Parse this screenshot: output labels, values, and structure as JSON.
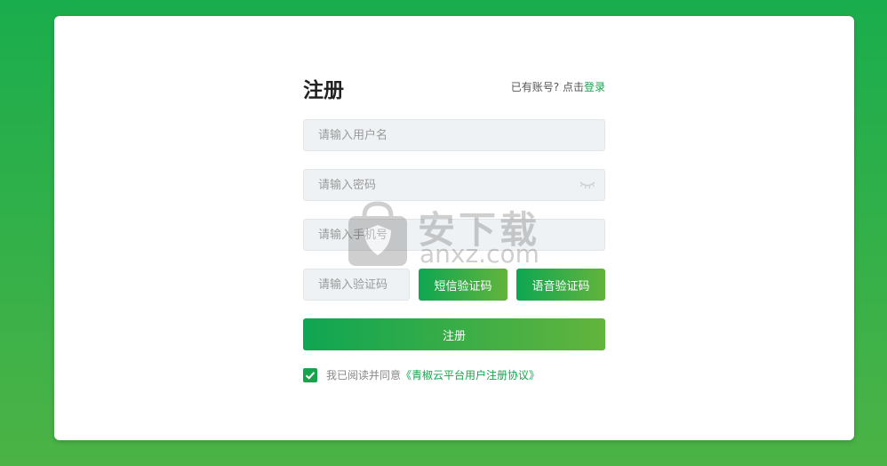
{
  "form": {
    "title": "注册",
    "login_prompt": "已有账号? 点击",
    "login_link": "登录",
    "username_placeholder": "请输入用户名",
    "password_placeholder": "请输入密码",
    "phone_placeholder": "请输入手机号",
    "code_placeholder": "请输入验证码",
    "sms_code_button": "短信验证码",
    "voice_code_button": "语音验证码",
    "submit_button": "注册"
  },
  "agreement": {
    "checked": true,
    "prefix": "我已阅读并同意",
    "link": "《青椒云平台用户注册协议》"
  },
  "watermark": {
    "text_cn": "安下载",
    "text_en": "anxz.com"
  },
  "icons": {
    "password_toggle": "eye-closed-icon",
    "checkbox": "checkmark-icon"
  },
  "colors": {
    "accent": "#14a54c",
    "background_top": "#1aad4d",
    "background_bottom": "#4cb346"
  }
}
